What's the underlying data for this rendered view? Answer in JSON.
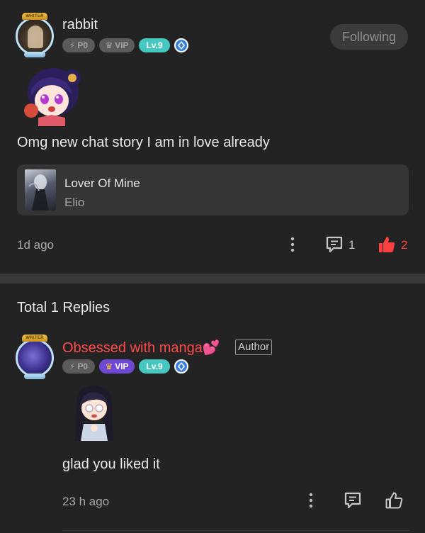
{
  "post": {
    "author": {
      "name": "rabbit",
      "avatar_frame_label": "WRITER",
      "badges": {
        "p_label": "P0",
        "vip_label": "VIP",
        "level_label": "Lv.9"
      }
    },
    "follow_label": "Following",
    "text": "Omg new chat story I am in love already",
    "book": {
      "title": "Lover Of Mine",
      "author": "Elio"
    },
    "time": "1d ago",
    "comment_count": "1",
    "like_count": "2"
  },
  "replies": {
    "header": "Total 1 Replies",
    "items": [
      {
        "author": {
          "name": "Obsessed with manga💕",
          "avatar_frame_label": "WRITER",
          "tag": "Author",
          "badges": {
            "p_label": "P0",
            "vip_label": "VIP",
            "level_label": "Lv.9"
          }
        },
        "text": "glad you liked it",
        "time": "23 h ago"
      }
    ]
  },
  "colors": {
    "background": "#232323",
    "accent_red": "#ff4040",
    "level_teal": "#46c7c0",
    "vip_purple": "#6f48d6"
  }
}
